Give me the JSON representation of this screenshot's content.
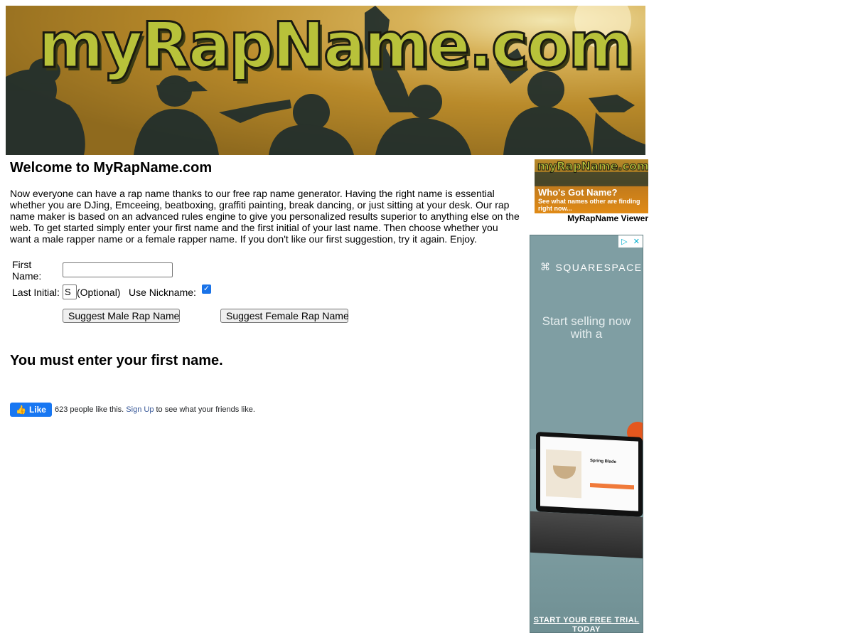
{
  "banner": {
    "title": "myRapName.com"
  },
  "main": {
    "heading": "Welcome to MyRapName.com",
    "intro": "Now everyone can have a rap name thanks to our free rap name generator. Having the right name is essential whether you are DJing, Emceeing, beatboxing, graffiti painting, break dancing, or just sitting at your desk. Our rap name maker is based on an advanced rules engine to give you personalized results superior to anything else on the web. To get started simply enter your first name and the first initial of your last name. Then choose whether you want a male rapper name or a female rapper name. If you don't like our first suggestion, try it again. Enjoy."
  },
  "form": {
    "first_name_label": "First Name:",
    "first_name_value": "",
    "last_initial_label": "Last Initial:",
    "last_initial_value": "S",
    "optional_label": "(Optional)",
    "nickname_label": "Use Nickname:",
    "nickname_checked": true,
    "male_button": "Suggest Male Rap Name",
    "female_button": "Suggest Female Rap Name"
  },
  "error_message": "You must enter your first name.",
  "facebook": {
    "like_label": "Like",
    "count_text": "623 people like this.",
    "signup_link": "Sign Up",
    "suffix_text": "to see what your friends like."
  },
  "viewer": {
    "logo": "myRapName.com",
    "headline": "Who's Got Name?",
    "subtext": "See what names other are finding right now...",
    "caption": "MyRapName Viewer"
  },
  "ad": {
    "brand": "SQUARESPACE",
    "tagline": "Start selling now with a",
    "product_name": "Spring Blade",
    "cta": "START YOUR FREE TRIAL TODAY",
    "colors": {
      "background": "#7f9ea3",
      "accent": "#f07a3a"
    }
  },
  "colors": {
    "banner_gold": "#b98a2a",
    "logo_green": "#b8c23a",
    "facebook_blue": "#1877f2",
    "checkbox_blue": "#1a73e8"
  }
}
